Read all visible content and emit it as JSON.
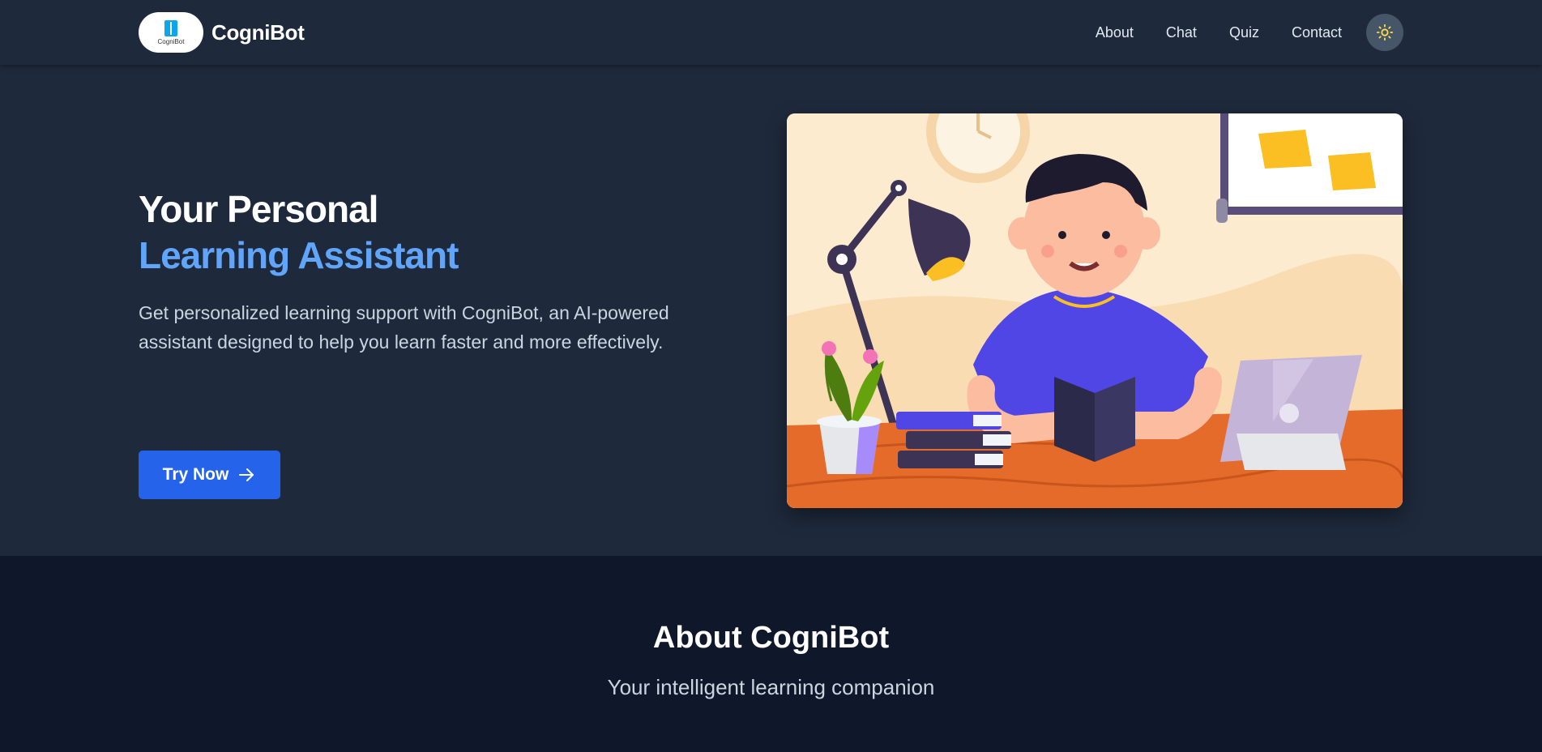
{
  "nav": {
    "brand_name": "CogniBot",
    "logo_text": "CogniBot",
    "links": [
      "About",
      "Chat",
      "Quiz",
      "Contact"
    ],
    "theme_icon": "sun-icon"
  },
  "hero": {
    "title_line1": "Your Personal",
    "title_line2": "Learning Assistant",
    "description": "Get personalized learning support with CogniBot, an AI-powered assistant designed to help you learn faster and more effectively.",
    "cta_label": "Try Now",
    "cta_icon": "arrow-right-icon",
    "image_icon": "student-studying-illustration"
  },
  "about": {
    "title": "About CogniBot",
    "subtitle": "Your intelligent learning companion"
  },
  "colors": {
    "accent": "#60a5fa",
    "button": "#2563eb",
    "navbar": "#1e293b",
    "page_bg": "#0f172a"
  }
}
